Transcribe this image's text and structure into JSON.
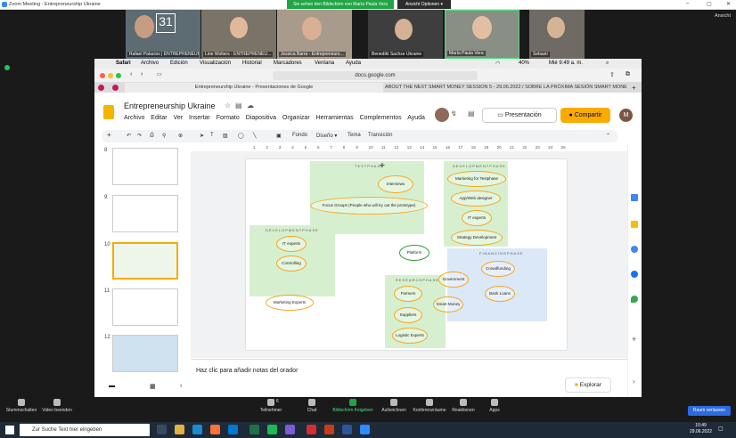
{
  "zoom": {
    "window_title": "Zoom Meeting - Entrepreneurship Ukraine",
    "share_banner": "Sie sehen den Bildschirm von María Paula Vera",
    "view_options": "Ansicht Optionen ▾",
    "view_label": "Ansicht",
    "participants": [
      {
        "name": "Rafael Palacios | ENTREPRENEURSHIP U..."
      },
      {
        "name": "Line Wolters - ENTREPRENEU..."
      },
      {
        "name": "Jessica Barra - Entrepreneurs..."
      },
      {
        "name": "Benedikt Sachse Ukraine"
      },
      {
        "name": "María Paula Vera"
      },
      {
        "name": "Sebasti"
      }
    ],
    "controls": [
      {
        "label": "Stummschalten"
      },
      {
        "label": "Video beenden"
      },
      {
        "label": "Teilnehmer"
      },
      {
        "label": "Chat"
      },
      {
        "label": "Bildschirm freigeben"
      },
      {
        "label": "Aufzeichnen"
      },
      {
        "label": "Konferenzräume"
      },
      {
        "label": "Reaktionen"
      },
      {
        "label": "Apps"
      }
    ],
    "participant_count": "6",
    "leave": "Raum verlassen"
  },
  "mac": {
    "menu": [
      "Safari",
      "Archivo",
      "Edición",
      "Visualización",
      "Historial",
      "Marcadores",
      "Ventana",
      "Ayuda"
    ],
    "battery": "40%",
    "clock": "Mié 9:49 a. m.",
    "url": "docs.google.com",
    "tab1": "Entrepreneurship Ukraine - Presentaciones de Google",
    "tab2": "ABOUT THE NEXT SMART MONEY SESSION 5 - 29.06.2022 / SOBRE LA PRÓXIMA SESIÓN SMART MONEY..."
  },
  "slides": {
    "doc_title": "Entrepreneurship Ukraine",
    "menu": [
      "Archivo",
      "Editar",
      "Ver",
      "Insertar",
      "Formato",
      "Diapositiva",
      "Organizar",
      "Herramientas",
      "Complementos",
      "Ayuda"
    ],
    "present": "Presentación",
    "share": "Compartir",
    "avatar": "M",
    "toolbar": {
      "fondo": "Fondo",
      "diseno": "Diseño ▾",
      "tema": "Tema",
      "transicion": "Transición"
    },
    "slide_numbers": [
      "8",
      "9",
      "10",
      "11",
      "12"
    ],
    "ruler_ticks": [
      "1",
      "2",
      "3",
      "4",
      "5",
      "6",
      "7",
      "8",
      "9",
      "10",
      "11",
      "12",
      "13",
      "14",
      "15",
      "16",
      "17",
      "18",
      "19",
      "20",
      "21",
      "22",
      "23",
      "24",
      "25"
    ],
    "notes_placeholder": "Haz clic para añadir notas del orador",
    "explore": "Explorar"
  },
  "diagram": {
    "testphase": "TESTPHASE",
    "dev_right": "DEVELOPMENTPHASE",
    "dev_left": "DEVELOPMENTPHASE",
    "research": "RESEARCHPHASE",
    "financing": "FINANCINGPHASE",
    "nodes": {
      "interviews": "Interviews",
      "focus": "Focus Groups (People who will try out the prototype)",
      "marketing_test": "Marketing for Testphase",
      "app_web": "App/Web designer",
      "it_right": "IT experts",
      "dev_team": "Strategy Development",
      "it_left": "IT experts",
      "controlling": "Controlling",
      "platform": "Platform",
      "marketing_experts": "Marketing Experts",
      "government": "Government",
      "farmers": "Farmers",
      "smart_money": "Smart Money",
      "suppliers": "Suppliers",
      "logistic": "Logistic Experts",
      "crowdfunding": "Crowdfunding",
      "bank_loans": "Bank Loans"
    }
  },
  "taskbar": {
    "search": "Zur Suche Text hier eingeben",
    "time": "10:49",
    "date": "29.06.2022"
  },
  "colors": {
    "green_zone": "#d6f0cf",
    "blue_zone": "#dbe8f8",
    "orange": "#f5a623",
    "zoom_green": "#22a447"
  }
}
